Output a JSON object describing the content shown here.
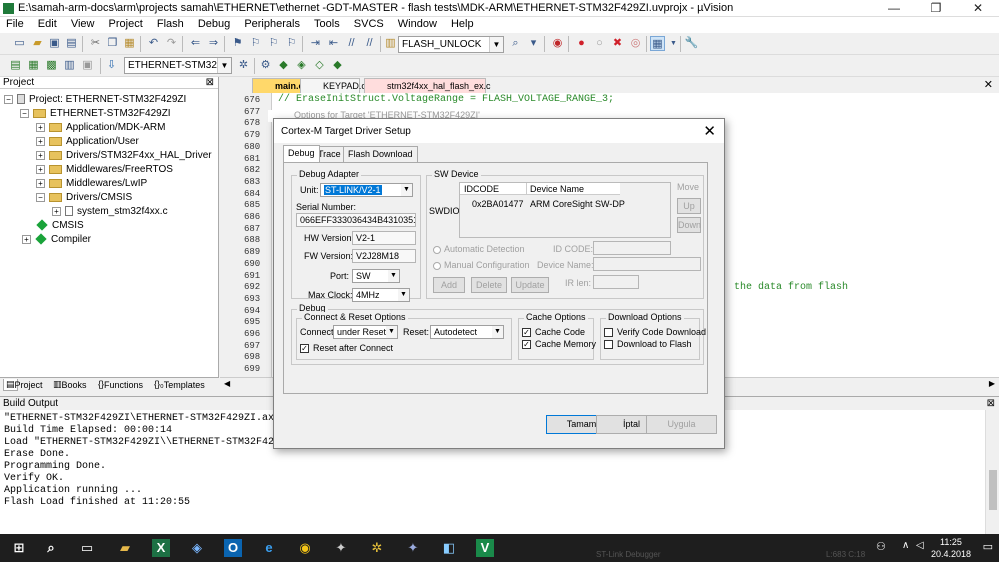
{
  "window": {
    "title": "E:\\samah-arm-docs\\arm\\projects samah\\ETHERNET\\ethernet -GDT-MASTER - flash tests\\MDK-ARM\\ETHERNET-STM32F429ZI.uvprojx - µVision",
    "minimize_glyph": "—",
    "restore_glyph": "❐",
    "close_glyph": "✕"
  },
  "menu": [
    "File",
    "Edit",
    "View",
    "Project",
    "Flash",
    "Debug",
    "Peripherals",
    "Tools",
    "SVCS",
    "Window",
    "Help"
  ],
  "toolbar": {
    "find_combo": "FLASH_UNLOCK",
    "target_combo": "ETHERNET-STM32F429ZI"
  },
  "project_pane": {
    "header": "Project",
    "pin": "⊠",
    "tree": [
      {
        "label": "Project: ETHERNET-STM32F429ZI",
        "kind": "root",
        "expander": "−"
      },
      {
        "label": "ETHERNET-STM32F429ZI",
        "kind": "target",
        "expander": "−"
      },
      {
        "label": "Application/MDK-ARM",
        "kind": "folder",
        "expander": "+"
      },
      {
        "label": "Application/User",
        "kind": "folder",
        "expander": "+"
      },
      {
        "label": "Drivers/STM32F4xx_HAL_Driver",
        "kind": "folder",
        "expander": "+"
      },
      {
        "label": "Middlewares/FreeRTOS",
        "kind": "folder",
        "expander": "+"
      },
      {
        "label": "Middlewares/LwIP",
        "kind": "folder",
        "expander": "+"
      },
      {
        "label": "Drivers/CMSIS",
        "kind": "folder",
        "expander": "−"
      },
      {
        "label": "system_stm32f4xx.c",
        "kind": "file",
        "expander": "+"
      },
      {
        "label": "CMSIS",
        "kind": "component",
        "expander": ""
      },
      {
        "label": "Compiler",
        "kind": "component",
        "expander": "+"
      }
    ],
    "tabs": [
      "Project",
      "Books",
      "Functions",
      "Templates"
    ]
  },
  "editor": {
    "tabs": [
      {
        "label": "main.c",
        "active": true
      },
      {
        "label": "KEYPAD.c",
        "active": false
      },
      {
        "label": "stm32f4xx_hal_flash_ex.c",
        "active": false
      }
    ],
    "close_glyph": "✕",
    "line_numbers": [
      "676",
      "677",
      "678",
      "679",
      "680",
      "681",
      "682",
      "683",
      "684",
      "685",
      "686",
      "687",
      "688",
      "689",
      "690",
      "691",
      "692",
      "693",
      "694",
      "695",
      "696",
      "697",
      "698",
      "699"
    ],
    "code_line_676": "//  EraseInitStruct.VoltageRange  = FLASH_VOLTAGE_RANGE_3;",
    "code_fragment_right": "the data from flash",
    "behind_title": "Options for Target 'ETHERNET-STM32F429ZI'"
  },
  "build_output": {
    "header": "Build Output",
    "lines": [
      "\"ETHERNET-STM32F429ZI\\ETHERNET-STM32F429ZI.axf\"",
      "Build Time Elapsed:  00:00:14",
      "Load \"ETHERNET-STM32F429ZI\\\\ETHERNET-STM32F429ZI.axf\"",
      "Erase Done.",
      "Programming Done.",
      "Verify OK.",
      "Application running ...",
      "Flash Load finished at 11:20:55"
    ]
  },
  "status_bar": {
    "debugger": "ST-Link Debugger",
    "position": "L:683 C:18",
    "build_tab": "Build Output"
  },
  "taskbar": {
    "time": "11:25",
    "date": "20.4.2018"
  },
  "dialog": {
    "title": "Cortex-M Target Driver Setup",
    "close_glyph": "✕",
    "tabs": [
      "Debug",
      "Trace",
      "Flash Download"
    ],
    "debug_adapter": {
      "group_label": "Debug Adapter",
      "unit_label": "Unit:",
      "unit_value": "ST-LINK/V2-1",
      "serial_label": "Serial Number:",
      "serial_value": "066EFF333036434B43103518",
      "hw_label": "HW Version:",
      "hw_value": "V2-1",
      "fw_label": "FW Version:",
      "fw_value": "V2J28M18",
      "port_label": "Port:",
      "port_value": "SW",
      "clock_label": "Max Clock:",
      "clock_value": "4MHz"
    },
    "sw_device": {
      "group_label": "SW Device",
      "swdio_label": "SWDIO",
      "col_idcode": "IDCODE",
      "col_device": "Device Name",
      "row_idcode": "0x2BA01477",
      "row_device": "ARM CoreSight SW-DP",
      "move_label": "Move",
      "up_label": "Up",
      "down_label": "Down",
      "auto_detect": "Automatic Detection",
      "manual_config": "Manual Configuration",
      "idcode_label": "ID CODE:",
      "devname_label": "Device Name:",
      "irlen_label": "IR len:",
      "add_label": "Add",
      "delete_label": "Delete",
      "update_label": "Update"
    },
    "debug_group": {
      "group_label": "Debug",
      "connect_reset_label": "Connect & Reset Options",
      "connect_label": "Connect:",
      "connect_value": "under Reset",
      "reset_label": "Reset:",
      "reset_value": "Autodetect",
      "reset_after_connect": "Reset after Connect",
      "cache_label": "Cache Options",
      "cache_code": "Cache Code",
      "cache_memory": "Cache Memory",
      "download_label": "Download Options",
      "verify_download": "Verify Code Download",
      "download_to_flash": "Download to Flash"
    },
    "buttons": {
      "ok": "Tamam",
      "cancel": "İptal",
      "apply": "Uygula"
    }
  }
}
